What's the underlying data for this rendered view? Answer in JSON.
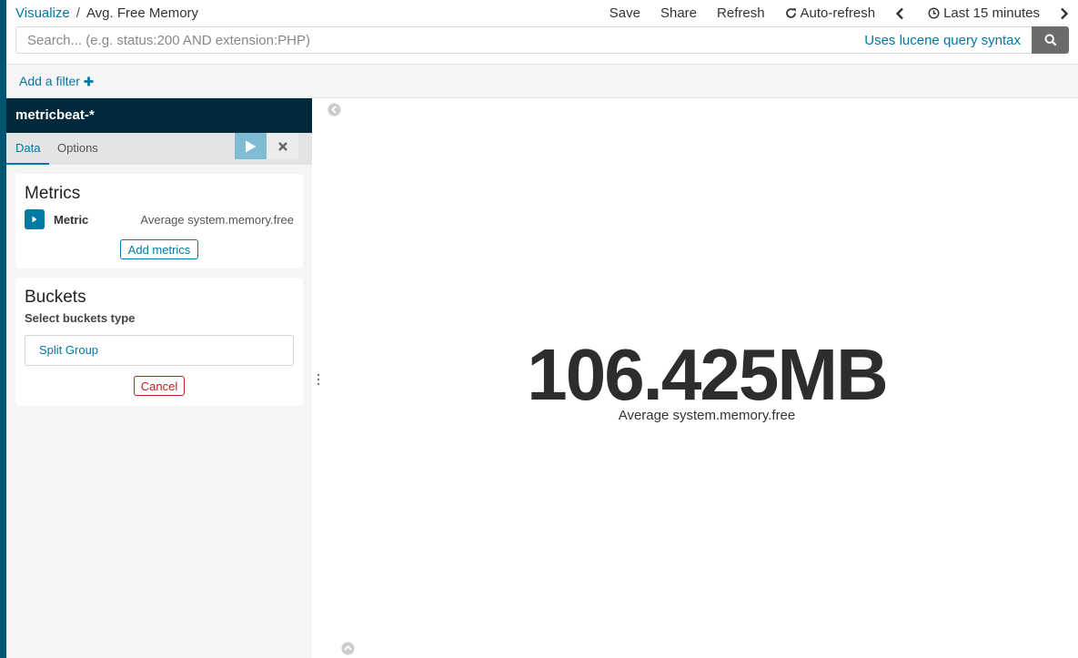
{
  "breadcrumb": {
    "parent": "Visualize",
    "separator": "/",
    "current": "Avg. Free Memory"
  },
  "topnav": {
    "save": "Save",
    "share": "Share",
    "refresh": "Refresh",
    "auto_refresh": "Auto-refresh",
    "time_range": "Last 15 minutes"
  },
  "search": {
    "placeholder": "Search... (e.g. status:200 AND extension:PHP)",
    "syntax_link": "Uses lucene query syntax"
  },
  "filter": {
    "add_label": "Add a filter"
  },
  "sidebar": {
    "index_pattern": "metricbeat-*",
    "tabs": {
      "data": "Data",
      "options": "Options"
    },
    "metrics": {
      "title": "Metrics",
      "row_label": "Metric",
      "row_value": "Average system.memory.free",
      "add_button": "Add metrics"
    },
    "buckets": {
      "title": "Buckets",
      "select_label": "Select buckets type",
      "option": "Split Group",
      "cancel": "Cancel"
    }
  },
  "viz": {
    "value": "106.425MB",
    "label": "Average system.memory.free"
  },
  "colors": {
    "accent": "#0079a5",
    "rail": "#005571",
    "header": "#00293b",
    "danger": "#bf1f1f"
  }
}
